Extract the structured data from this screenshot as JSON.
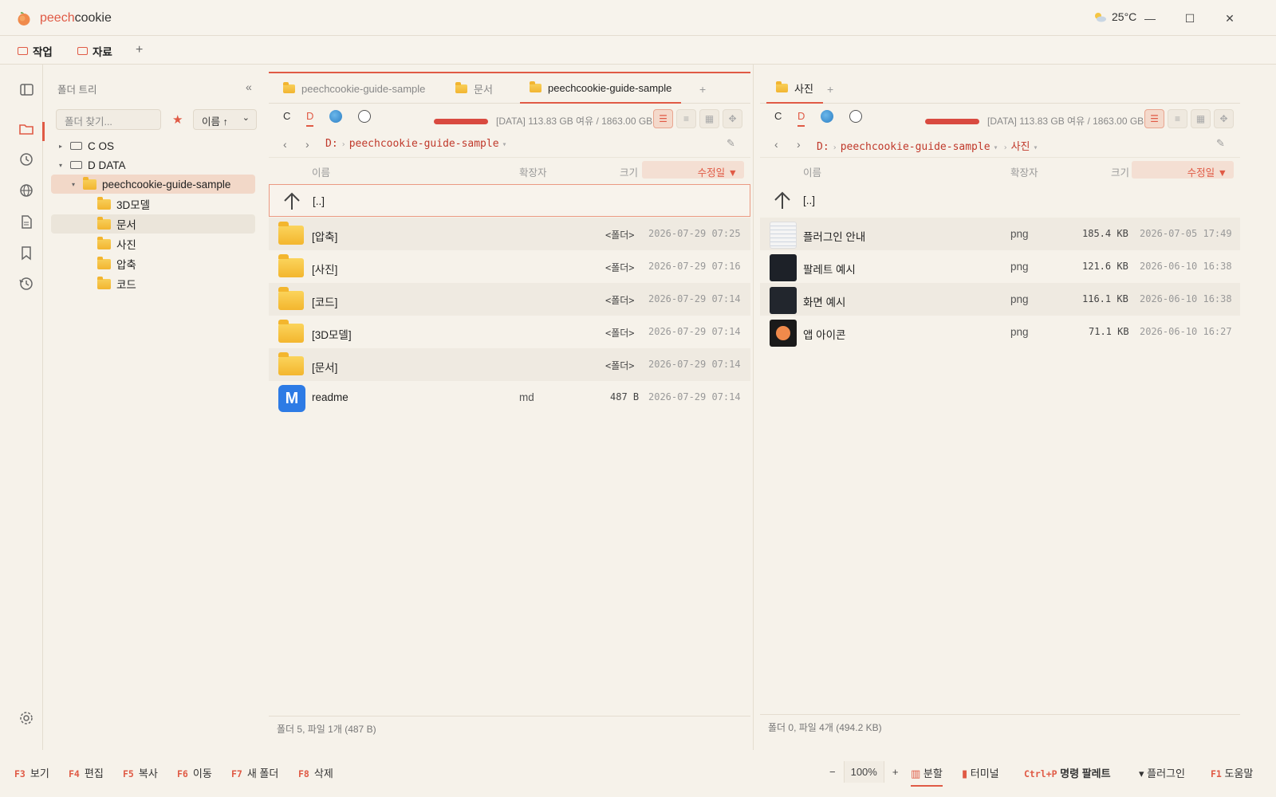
{
  "app": {
    "brand_1": "peech",
    "brand_2": "cookie",
    "weather": "25°C"
  },
  "workspace_tabs": [
    {
      "label": "작업"
    },
    {
      "label": "자료"
    }
  ],
  "tree": {
    "title": "폴더 트리",
    "collapse": "«",
    "search_placeholder": "폴더 찾기...",
    "sort_label": "이름 ↑",
    "nodes": [
      {
        "label": "C OS"
      },
      {
        "label": "D DATA"
      },
      {
        "label": "peechcookie-guide-sample"
      },
      {
        "label": "3D모델"
      },
      {
        "label": "문서"
      },
      {
        "label": "사진"
      },
      {
        "label": "압축"
      },
      {
        "label": "코드"
      }
    ]
  },
  "left_pane": {
    "tabs": [
      "peechcookie-guide-sample",
      "문서",
      "peechcookie-guide-sample"
    ],
    "drives": [
      "C",
      "D"
    ],
    "usage_text": "[DATA] 113.83 GB 여유 / 1863.00 GB",
    "path_drive": "D:",
    "path": [
      "peechcookie-guide-sample"
    ],
    "columns": {
      "name": "이름",
      "ext": "확장자",
      "size": "크기",
      "date": "수정일 ▼"
    },
    "rows": [
      {
        "name": "[..]",
        "ext": "",
        "size": "",
        "date": ""
      },
      {
        "name": "[압축]",
        "ext": "",
        "size": "<폴더>",
        "date": "2026-07-29 07:25"
      },
      {
        "name": "[사진]",
        "ext": "",
        "size": "<폴더>",
        "date": "2026-07-29 07:16"
      },
      {
        "name": "[코드]",
        "ext": "",
        "size": "<폴더>",
        "date": "2026-07-29 07:14"
      },
      {
        "name": "[3D모델]",
        "ext": "",
        "size": "<폴더>",
        "date": "2026-07-29 07:14"
      },
      {
        "name": "[문서]",
        "ext": "",
        "size": "<폴더>",
        "date": "2026-07-29 07:14"
      },
      {
        "name": "readme",
        "ext": "md",
        "size": "487 B",
        "date": "2026-07-29 07:14"
      }
    ],
    "footer": "폴더 5, 파일 1개 (487 B)"
  },
  "right_pane": {
    "tabs": [
      "사진"
    ],
    "drives": [
      "C",
      "D"
    ],
    "usage_text": "[DATA] 113.83 GB 여유 / 1863.00 GB",
    "path_drive": "D:",
    "path": [
      "peechcookie-guide-sample",
      "사진"
    ],
    "columns": {
      "name": "이름",
      "ext": "확장자",
      "size": "크기",
      "date": "수정일 ▼"
    },
    "rows": [
      {
        "name": "[..]",
        "ext": "",
        "size": "",
        "date": ""
      },
      {
        "name": "플러그인 안내",
        "ext": "png",
        "size": "185.4 KB",
        "date": "2026-07-05 17:49"
      },
      {
        "name": "팔레트 예시",
        "ext": "png",
        "size": "121.6 KB",
        "date": "2026-06-10 16:38"
      },
      {
        "name": "화면 예시",
        "ext": "png",
        "size": "116.1 KB",
        "date": "2026-06-10 16:38"
      },
      {
        "name": "앱 아이콘",
        "ext": "png",
        "size": "71.1 KB",
        "date": "2026-06-10 16:27"
      }
    ],
    "footer": "폴더 0, 파일 4개 (494.2 KB)"
  },
  "status": {
    "fkeys": [
      {
        "key": "F3",
        "label": "보기"
      },
      {
        "key": "F4",
        "label": "편집"
      },
      {
        "key": "F5",
        "label": "복사"
      },
      {
        "key": "F6",
        "label": "이동"
      },
      {
        "key": "F7",
        "label": "새 폴더"
      },
      {
        "key": "F8",
        "label": "삭제"
      }
    ],
    "zoom": "100%",
    "split": "분할",
    "terminal": "터미널",
    "palette_key": "Ctrl+P",
    "palette": "명령 팔레트",
    "plugins": "플러그인",
    "help_key": "F1",
    "help": "도움말"
  },
  "colors": {
    "accent": "#e05a45",
    "usage_bar": "#d94a40",
    "folder": "#f3b62e"
  }
}
